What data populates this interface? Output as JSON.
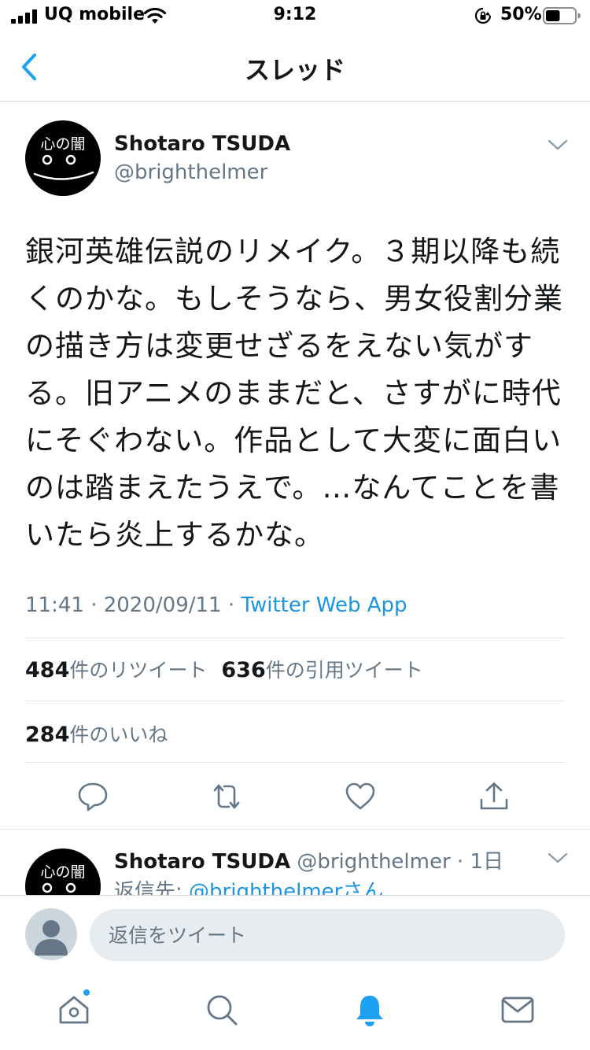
{
  "status_bar": {
    "carrier": "UQ mobile",
    "time": "9:12",
    "battery_percent": "50%",
    "battery_level": 0.5
  },
  "nav": {
    "back_icon": "chevron-left-icon",
    "title": "スレッド"
  },
  "tweet": {
    "author_name": "Shotaro TSUDA",
    "author_handle": "@brighthelmer",
    "text": "銀河英雄伝説のリメイク。３期以降も続くのかな。もしそうなら、男女役割分業の描き方は変更せざるをえない気がする。旧アニメのままだと、さすがに時代にそぐわない。作品として大変に面白いのは踏まえたうえで。…なんてことを書いたら炎上するかな。",
    "timestamp": "11:41 · 2020/09/11 · ",
    "source": "Twitter Web App",
    "retweet_count": "484",
    "retweet_label": "件のリツイート",
    "quote_count": "636",
    "quote_label": "件の引用ツイート",
    "like_count": "284",
    "like_label": "件のいいね",
    "actions": [
      "reply-icon",
      "retweet-icon",
      "like-icon",
      "share-icon"
    ]
  },
  "reply": {
    "author_name": "Shotaro TSUDA",
    "author_handle": "@brighthelmer",
    "age": " · 1日",
    "reply_to_prefix": "返信先: ",
    "reply_to_handle": "@brighthelmerさん"
  },
  "avatar_art": {
    "text": "心の闇"
  },
  "composer": {
    "placeholder": "返信をツイート"
  },
  "tabbar": {
    "items": [
      "home-icon",
      "search-icon",
      "notifications-icon",
      "messages-icon"
    ],
    "active": "notifications-icon",
    "home_has_new": true
  },
  "colors": {
    "accent": "#1da1f2",
    "link": "#1b95e0",
    "secondary_text": "#657786",
    "primary_text": "#14171a"
  }
}
